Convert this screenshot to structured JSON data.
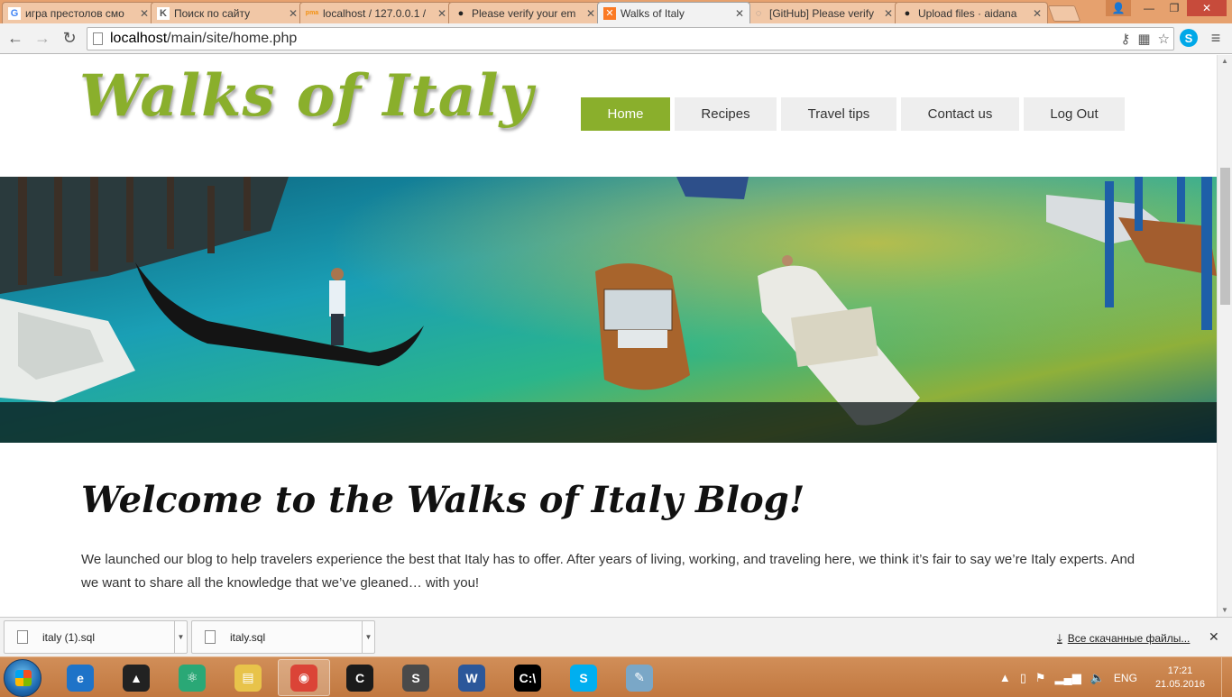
{
  "browser": {
    "tabs": [
      {
        "title": "игра престолов смо",
        "favicon": "google-icon",
        "active": false
      },
      {
        "title": "Поиск по сайту",
        "favicon": "kinopoisk-icon",
        "active": false
      },
      {
        "title": "localhost / 127.0.0.1 /",
        "favicon": "phpmyadmin-icon",
        "active": false
      },
      {
        "title": "Please verify your em",
        "favicon": "github-icon",
        "active": false
      },
      {
        "title": "Walks of Italy",
        "favicon": "xampp-icon",
        "active": true
      },
      {
        "title": "[GitHub] Please verify",
        "favicon": "loading-icon",
        "active": false
      },
      {
        "title": "Upload files · aidana",
        "favicon": "github-icon",
        "active": false
      }
    ],
    "url_host": "localhost",
    "url_path": "/main/site/home.php"
  },
  "site": {
    "logo": "Walks of Italy",
    "nav": [
      {
        "label": "Home",
        "active": true
      },
      {
        "label": "Recipes",
        "active": false
      },
      {
        "label": "Travel tips",
        "active": false
      },
      {
        "label": "Contact us",
        "active": false
      },
      {
        "label": "Log Out",
        "active": false
      }
    ],
    "hero_alt": "",
    "welcome_title": "Welcome to the Walks of Italy Blog!",
    "intro_text": "We launched our blog to help travelers experience the best that Italy has to offer. After years of living, working, and traveling here, we think it’s fair to say we’re Italy experts. And we want to share all the knowledge that we’ve gleaned… with you!"
  },
  "downloads": {
    "items": [
      {
        "name": "italy (1).sql"
      },
      {
        "name": "italy.sql"
      }
    ],
    "show_all": "Все скачанные файлы...",
    "close": "✕"
  },
  "taskbar": {
    "apps": [
      {
        "name": "internet-explorer",
        "glyph": "e",
        "color": "#1e73c8"
      },
      {
        "name": "aimp",
        "glyph": "▲",
        "color": "#222222"
      },
      {
        "name": "atom",
        "glyph": "⚛",
        "color": "#2aa876"
      },
      {
        "name": "file-explorer",
        "glyph": "▤",
        "color": "#e8c34a"
      },
      {
        "name": "chrome",
        "glyph": "◉",
        "color": "#db4437"
      },
      {
        "name": "terminal-app",
        "glyph": "C",
        "color": "#1b1b1b"
      },
      {
        "name": "sublime-text",
        "glyph": "S",
        "color": "#4a4a4a"
      },
      {
        "name": "word",
        "glyph": "W",
        "color": "#2b579a"
      },
      {
        "name": "cmd",
        "glyph": "C:\\",
        "color": "#000000"
      },
      {
        "name": "skype",
        "glyph": "S",
        "color": "#00aff0"
      },
      {
        "name": "paint",
        "glyph": "✎",
        "color": "#7aa7c7"
      }
    ],
    "lang": "ENG",
    "time": "17:21",
    "date": "21.05.2016"
  },
  "colors": {
    "accent_green": "#8aaf2c",
    "titlebar": "#e6a16e"
  }
}
